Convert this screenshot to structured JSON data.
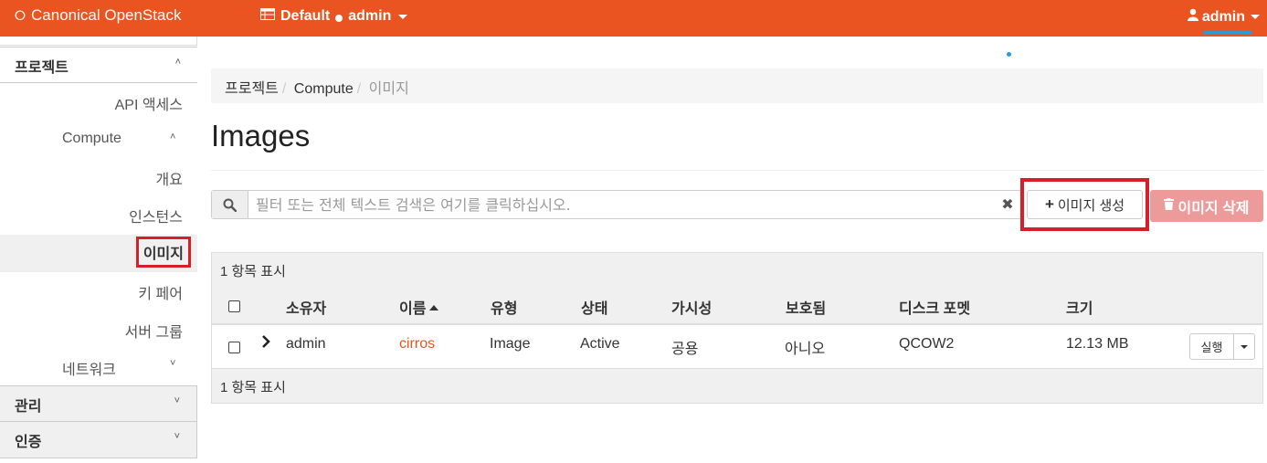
{
  "topbar": {
    "brand": "Canonical OpenStack",
    "domain": "Default",
    "project": "admin",
    "user": "admin",
    "accent": "#e95420"
  },
  "sidebar": {
    "project_section": "프로젝트",
    "api_access": "API 액세스",
    "compute": "Compute",
    "overview": "개요",
    "instances": "인스턴스",
    "images": "이미지",
    "key_pairs": "키 페어",
    "server_groups": "서버 그룹",
    "network": "네트워크",
    "admin_section": "관리",
    "identity_section": "인증"
  },
  "breadcrumb": {
    "root": "프로젝트",
    "compute": "Compute",
    "current": "이미지"
  },
  "page": {
    "title": "Images"
  },
  "filter": {
    "placeholder": "필터 또는 전체 텍스트 검색은 여기를 클릭하십시오."
  },
  "actions": {
    "create": "이미지 생성",
    "delete": "이미지 삭제"
  },
  "table": {
    "summary": "1 항목 표시",
    "headers": {
      "owner": "소유자",
      "name": "이름",
      "type": "유형",
      "status": "상태",
      "visibility": "가시성",
      "protected": "보호됨",
      "disk_format": "디스크 포멧",
      "size": "크기"
    },
    "rows": [
      {
        "owner": "admin",
        "name": "cirros",
        "type": "Image",
        "status": "Active",
        "visibility": "공용",
        "protected": "아니오",
        "disk_format": "QCOW2",
        "size": "12.13 MB",
        "action": "실행"
      }
    ],
    "footer": "1 항목 표시"
  }
}
